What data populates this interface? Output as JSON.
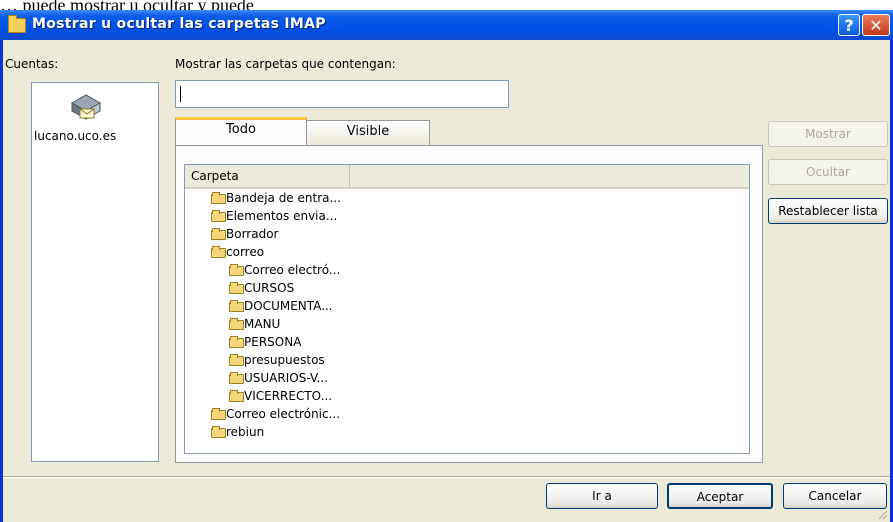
{
  "background_document": {
    "text": "… puede mostrar u ocultar y puede"
  },
  "window": {
    "title": "Mostrar u ocultar las carpetas IMAP",
    "help_button": "?",
    "close_button": "✕"
  },
  "accounts": {
    "label": "Cuentas:",
    "items": [
      {
        "name": "lucano.uco.es",
        "icon": "mail-server-icon"
      }
    ]
  },
  "search": {
    "label": "Mostrar las carpetas que contengan:",
    "value": ""
  },
  "tabs": [
    {
      "label": "Todo",
      "active": true
    },
    {
      "label": "Visible",
      "active": false
    }
  ],
  "folder_list": {
    "column_header": "Carpeta",
    "folders": [
      {
        "name": "Bandeja de entra...",
        "level": 1,
        "icon": "inbox-folder-icon"
      },
      {
        "name": "Elementos envia...",
        "level": 1,
        "icon": "sent-folder-icon"
      },
      {
        "name": "Borrador",
        "level": 1,
        "icon": "drafts-folder-icon"
      },
      {
        "name": "correo",
        "level": 1,
        "icon": "folder-icon"
      },
      {
        "name": "Correo electró...",
        "level": 2,
        "icon": "folder-icon"
      },
      {
        "name": "CURSOS",
        "level": 2,
        "icon": "folder-icon"
      },
      {
        "name": "DOCUMENTA...",
        "level": 2,
        "icon": "folder-icon"
      },
      {
        "name": "MANU",
        "level": 2,
        "icon": "folder-icon"
      },
      {
        "name": "PERSONA",
        "level": 2,
        "icon": "folder-icon"
      },
      {
        "name": "presupuestos",
        "level": 2,
        "icon": "folder-icon"
      },
      {
        "name": "USUARIOS-V...",
        "level": 2,
        "icon": "folder-icon"
      },
      {
        "name": "VICERRECTO...",
        "level": 2,
        "icon": "folder-icon"
      },
      {
        "name": "Correo electrónic...",
        "level": 1,
        "icon": "folder-icon"
      },
      {
        "name": "rebiun",
        "level": 1,
        "icon": "folder-icon"
      }
    ]
  },
  "side_buttons": {
    "show": "Mostrar",
    "hide": "Ocultar",
    "reset": "Restablecer lista"
  },
  "bottom_buttons": {
    "goto": "Ir a",
    "ok": "Aceptar",
    "cancel": "Cancelar"
  },
  "colors": {
    "titlebar": "#0051e5",
    "dialog_bg": "#ece9d8",
    "active_tab_accent": "#ffc83c",
    "button_border": "#003c74"
  }
}
